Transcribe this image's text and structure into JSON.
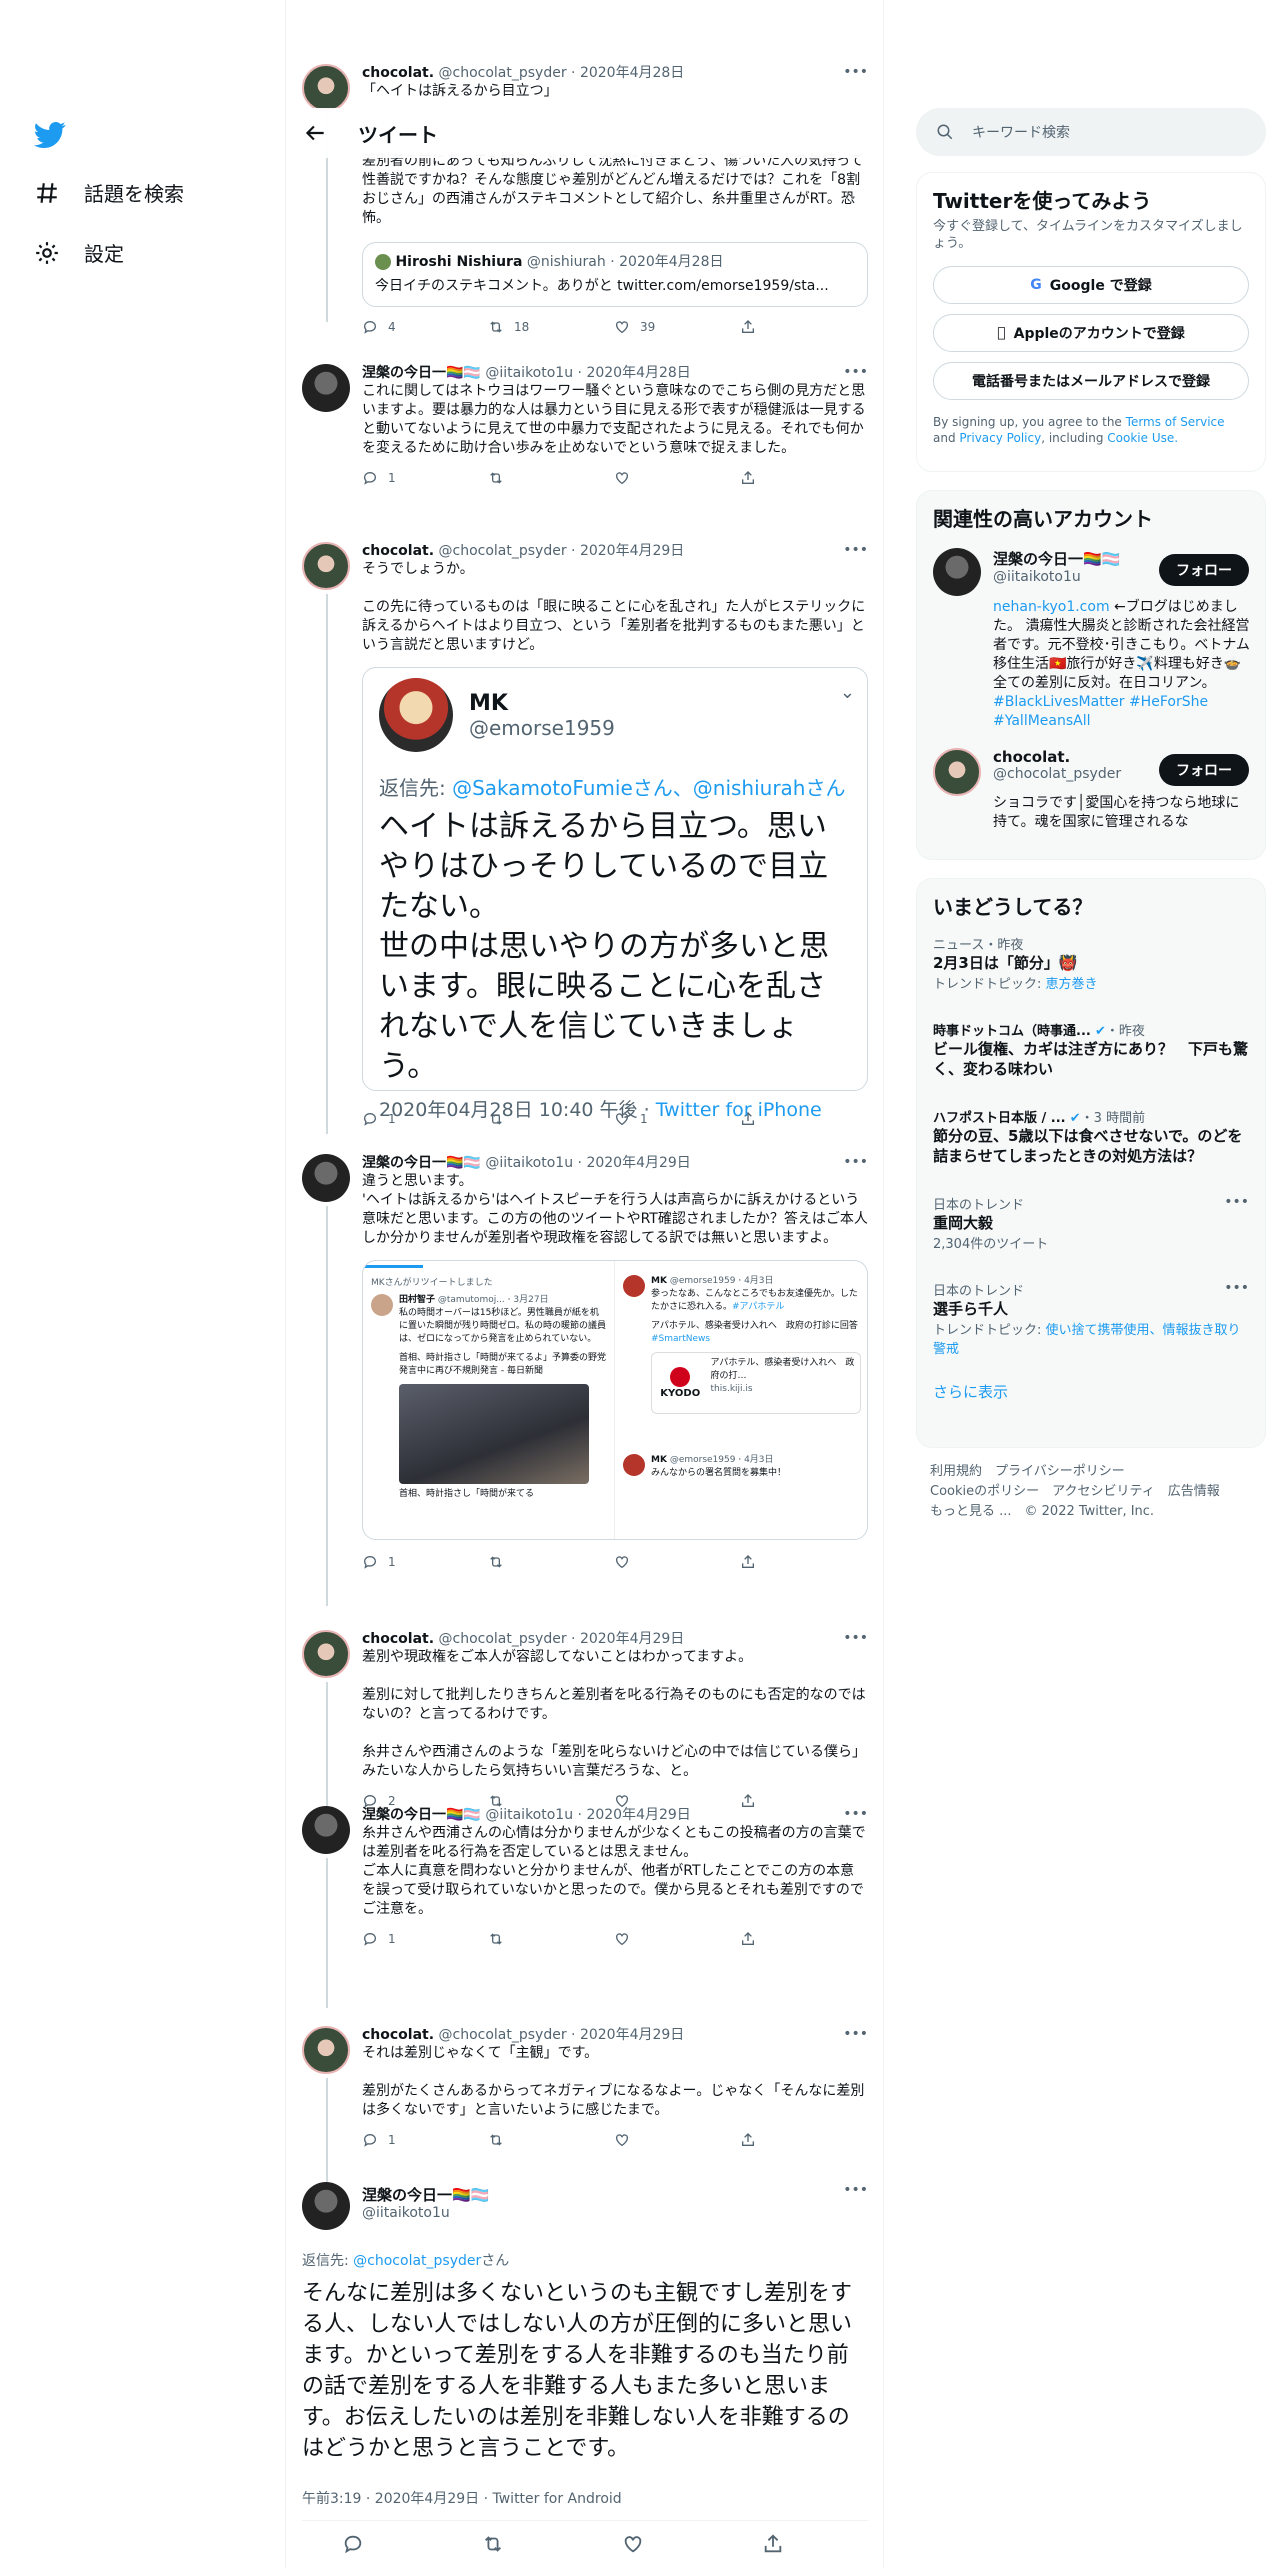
{
  "nav": {
    "explore_label": "話題を検索",
    "settings_label": "設定"
  },
  "header": {
    "title": "ツイート"
  },
  "top_tweet": {
    "name": "chocolat.",
    "handle": "@chocolat_psyder",
    "date": "2020年4月28日",
    "text": "「ヘイトは訴えるから目立つ」"
  },
  "tweet_a": {
    "text": "差別者の前にあっても知らんぷりして沈黙に付きまとう、傷ついた人の気持って性善説ですかね？そんな態度じゃ差別がどんどん増えるだけでは？これを「8割おじさん」の西浦さんがステキコメントとして紹介し、糸井重里さんがRT。恐怖。",
    "quote": {
      "name": "Hiroshi Nishiura",
      "handle": "@nishiurah",
      "date": "2020年4月28日",
      "text": "今日イチのステキコメント。ありがと twitter.com/emorse1959/sta..."
    },
    "replies": "4",
    "retweets": "18",
    "likes": "39"
  },
  "tweet_b": {
    "name": "涅槃の今日一🏳️‍🌈🏳️‍⚧️",
    "handle": "@iitaikoto1u",
    "date": "2020年4月28日",
    "text": "これに関してはネトウヨはワーワー騒ぐという意味なのでこちら側の見方だと思いますよ。要は暴力的な人は暴力という目に見える形で表すが穏健派は一見すると動いてないように見えて世の中暴力で支配されたように見える。それでも何かを変えるために助け合い歩みを止めないでという意味で捉えました。",
    "replies": "1"
  },
  "tweet_c": {
    "name": "chocolat.",
    "handle": "@chocolat_psyder",
    "date": "2020年4月29日",
    "text": "そうでしょうか。\n\nこの先に待っているものは「眼に映ることに心を乱され」た人がヒステリックに訴えるからヘイトはより目立つ、という「差別者を批判するものもまた悪い」という言説だと思いますけど。",
    "mk": {
      "name": "MK",
      "handle": "@emorse1959",
      "reply_label": "返信先:",
      "reply_to": "@SakamotoFumieさん、@nishiurahさん",
      "text": "ヘイトは訴えるから目立つ。思いやりはひっそりしているので目立たない。\n世の中は思いやりの方が多いと思います。眼に映ることに心を乱されないで人を信じていきましょう。",
      "time": "2020年04月28日 10:40 午後",
      "source_sep": "·",
      "source": "Twitter for iPhone"
    },
    "replies": "1",
    "likes": "1"
  },
  "tweet_d": {
    "name": "涅槃の今日一🏳️‍🌈🏳️‍⚧️",
    "handle": "@iitaikoto1u",
    "date": "2020年4月29日",
    "text": "違うと思います。\n'ヘイトは訴えるから'はヘイトスピーチを行う人は声高らかに訴えかけるという意味だと思います。この方の他のツイートやRT確認されましたか？答えはご本人しか分かりませんが差別者や現政権を容認してる訳では無いと思いますよ。",
    "shot": {
      "rt_label": "MKさんがリツイートしました",
      "left_name": "田村智子",
      "left_handle": "@tamutomoj...",
      "left_date": "3月27日",
      "left_text": "私の時間オーバーは15秒ほど。男性職員が紙を机に置いた瞬間が残り時間ゼロ。私の時の暖節の議員は、ゼロになってから発言を止められていない。",
      "left_text2": "首相、時計指さし「時間が来てるよ」予算委の野党発言中に再び不規則発言 - 毎日新聞",
      "left_cap": "首相、時計指さし「時間が来てる",
      "right_name": "MK",
      "right_handle": "@emorse1959",
      "right_date": "4月3日",
      "right_text": "参ったなあ、こんなところでもお友達優先か。したたかさに恐れ入る。",
      "right_tag": "#アパホテル",
      "right_text2": "アパホテル、感染者受け入れへ　政府の打診に回答",
      "right_tag2": "#SmartNews",
      "logo": "KYODO",
      "card_text": "アパホテル、感染者受け入れへ　政府の打…",
      "card_domain": "this.kiji.is",
      "right2_name": "MK",
      "right2_handle": "@emorse1959",
      "right2_date": "4月3日",
      "right2_text": "みんなからの署名質問を募集中！"
    },
    "replies": "1"
  },
  "tweet_e": {
    "name": "chocolat.",
    "handle": "@chocolat_psyder",
    "date": "2020年4月29日",
    "text": "差別や現政権をご本人が容認してないことはわかってますよ。\n\n差別に対して批判したりきちんと差別者を叱る行為そのものにも否定的なのではないの？と言ってるわけです。\n\n糸井さんや西浦さんのような「差別を叱らないけど心の中では信じている僕ら」みたいな人からしたら気持ちいい言葉だろうな、と。",
    "replies": "2"
  },
  "tweet_f": {
    "name": "涅槃の今日一🏳️‍🌈🏳️‍⚧️",
    "handle": "@iitaikoto1u",
    "date": "2020年4月29日",
    "text": "糸井さんや西浦さんの心情は分かりませんが少なくともこの投稿者の方の言葉では差別者を叱る行為を否定しているとは思えません。\nご本人に真意を問わないと分かりませんが、他者がRTしたことでこの方の本意を誤って受け取られていないかと思ったので。僕から見るとそれも差別ですのでご注意を。",
    "replies": "1"
  },
  "tweet_g": {
    "name": "chocolat.",
    "handle": "@chocolat_psyder",
    "date": "2020年4月29日",
    "text": "それは差別じゃなくて「主観」です。\n\n差別がたくさんあるからってネガティブになるなよー。じゃなく「そんなに差別は多くないです」と言いたいように感じたまで。",
    "replies": "1"
  },
  "main_tweet": {
    "name": "涅槃の今日一🏳️‍🌈🏳️‍⚧️",
    "handle": "@iitaikoto1u",
    "reply_label": "返信先:",
    "reply_to": "@chocolat_psyder",
    "reply_suffix": "さん",
    "text": "そんなに差別は多くないというのも主観ですし差別をする人、しない人ではしない人の方が圧倒的に多いと思います。かといって差別をする人を非難するのも当たり前の話で差別をする人を非難する人もまた多いと思います。お伝えしたいのは差別を非難しない人を非難するのはどうかと思うと言うことです。",
    "meta": "午前3:19 · 2020年4月29日 · Twitter for Android"
  },
  "right": {
    "search_placeholder": "キーワード検索",
    "signup": {
      "title": "Twitterを使ってみよう",
      "desc": "今すぐ登録して、タイムラインをカスタマイズしましょう。",
      "google": "Google で登録",
      "apple": "Appleのアカウントで登録",
      "phone": "電話番号またはメールアドレスで登録",
      "terms_prefix": "By signing up, you agree to the",
      "terms": "Terms of Service",
      "and": "and",
      "privacy": "Privacy Policy",
      "including": ", including",
      "cookie": "Cookie Use."
    },
    "related": {
      "title": "関連性の高いアカウント",
      "follow": "フォロー",
      "acc1": {
        "name": "涅槃の今日一🏳️‍🌈🏳️‍⚧️",
        "handle": "@iitaikoto1u",
        "bio_link": "nehan-kyo1.com",
        "bio": "←ブログはじめました。 潰瘍性大腸炎と診断された会社経営者です。元不登校･引きこもり。ベトナム移住生活🇻🇳旅行が好き✈️料理も好き🍲 全ての差別に反対。在日コリアン。",
        "tag1": "#BlackLivesMatter",
        "tag2": "#HeForShe",
        "tag3": "#YallMeansAll"
      },
      "acc2": {
        "name": "chocolat.",
        "handle": "@chocolat_psyder",
        "bio": "ショコラです│愛国心を持つなら地球に持て。魂を国家に管理されるな"
      }
    },
    "trends": {
      "title": "いまどうしてる？",
      "items": [
        {
          "meta": "ニュース・昨夜",
          "topic": "2月3日は「節分」👹",
          "sub_label": "トレンドトピック:",
          "sub_link": "恵方巻き"
        },
        {
          "source": "時事ドットコム（時事通...",
          "time": "・昨夜",
          "topic": "ビール復権、カギは注ぎ方にあり？　下戸も驚く、変わる味わい"
        },
        {
          "source": "ハフポスト日本版 / ...",
          "time": "・3 時間前",
          "topic": "節分の豆、5歳以下は食べさせないで。のどを詰まらせてしまったときの対処方法は？"
        },
        {
          "meta": "日本のトレンド",
          "topic": "重岡大毅",
          "sub": "2,304件のツイート"
        },
        {
          "meta": "日本のトレンド",
          "topic": "選手ら千人",
          "sub_label": "トレンドトピック:",
          "sub_link": "使い捨て携帯使用、情報抜き取り警戒"
        }
      ],
      "more": "さらに表示"
    },
    "footer": {
      "l1": "利用規約　プライバシーポリシー",
      "l2": "Cookieのポリシー　アクセシビリティ　広告情報",
      "l3": "もっと見る ...　© 2022 Twitter, Inc."
    }
  },
  "colors": {
    "accent": "#1d9bf0",
    "text": "#0f1419",
    "muted": "#536471",
    "border": "#cfd9de"
  }
}
